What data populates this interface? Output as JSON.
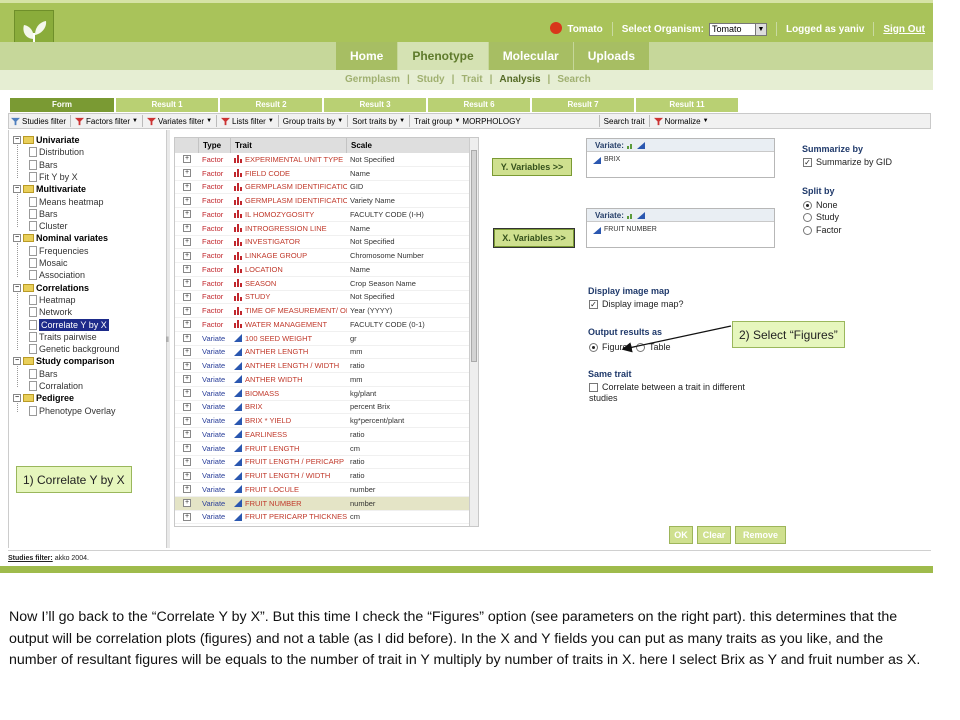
{
  "header": {
    "organism_short": "Tomato",
    "select_organism_label": "Select Organism:",
    "organism_selected": "Tomato",
    "logged_as": "Logged as yaniv",
    "sign_out": "Sign Out"
  },
  "main_tabs": [
    "Home",
    "Phenotype",
    "Molecular",
    "Uploads"
  ],
  "main_tab_active": "Phenotype",
  "sub_nav": [
    "Germplasm",
    "Study",
    "Trait",
    "Analysis",
    "Search"
  ],
  "sub_nav_active": "Analysis",
  "result_tabs": [
    "Form",
    "Result 1",
    "Result 2",
    "Result 3",
    "Result 6",
    "Result 7",
    "Result 11"
  ],
  "toolbar": {
    "studies_filter": "Studies filter",
    "factors_filter": "Factors filter",
    "variates_filter": "Variates filter",
    "lists_filter": "Lists filter",
    "group_traits_by": "Group traits by",
    "sort_traits_by": "Sort traits by",
    "trait_group": "Trait group",
    "trait_group_value": "MORPHOLOGY",
    "search_trait": "Search trait",
    "normalize": "Normalize"
  },
  "tree": {
    "groups": [
      {
        "label": "Univariate",
        "items": [
          "Distribution",
          "Bars",
          "Fit Y by X"
        ]
      },
      {
        "label": "Multivariate",
        "items": [
          "Means heatmap",
          "Bars",
          "Cluster"
        ]
      },
      {
        "label": "Nominal variates",
        "items": [
          "Frequencies",
          "Mosaic",
          "Association"
        ]
      },
      {
        "label": "Correlations",
        "items": [
          "Heatmap",
          "Network",
          "Correlate Y by X",
          "Traits pairwise",
          "Genetic background"
        ]
      },
      {
        "label": "Study comparison",
        "items": [
          "Bars",
          "Corralation"
        ]
      },
      {
        "label": "Pedigree",
        "items": [
          "Phenotype Overlay"
        ]
      }
    ],
    "selected": "Correlate Y by X"
  },
  "table": {
    "headers": [
      "Type",
      "Trait",
      "Scale"
    ],
    "rows": [
      {
        "type": "Factor",
        "trait": "EXPERIMENTAL UNIT TYPE",
        "scale": "Not Specified"
      },
      {
        "type": "Factor",
        "trait": "FIELD CODE",
        "scale": "Name"
      },
      {
        "type": "Factor",
        "trait": "GERMPLASM IDENTIFICATION",
        "scale": "GID"
      },
      {
        "type": "Factor",
        "trait": "GERMPLASM IDENTIFICATION",
        "scale": "Variety Name"
      },
      {
        "type": "Factor",
        "trait": "IL HOMOZYGOSITY",
        "scale": "FACULTY CODE (I-H)"
      },
      {
        "type": "Factor",
        "trait": "INTROGRESSION LINE",
        "scale": "Name"
      },
      {
        "type": "Factor",
        "trait": "INVESTIGATOR",
        "scale": "Not Specified"
      },
      {
        "type": "Factor",
        "trait": "LINKAGE GROUP",
        "scale": "Chromosome Number"
      },
      {
        "type": "Factor",
        "trait": "LOCATION",
        "scale": "Name"
      },
      {
        "type": "Factor",
        "trait": "SEASON",
        "scale": "Crop Season Name"
      },
      {
        "type": "Factor",
        "trait": "STUDY",
        "scale": "Not Specified"
      },
      {
        "type": "Factor",
        "trait": "TIME OF MEASUREMENT/ OBSE",
        "scale": "Year (YYYY)"
      },
      {
        "type": "Factor",
        "trait": "WATER MANAGEMENT",
        "scale": "FACULTY CODE (0-1)"
      },
      {
        "type": "Variate",
        "trait": "100 SEED WEIGHT",
        "scale": "gr"
      },
      {
        "type": "Variate",
        "trait": "ANTHER LENGTH",
        "scale": "mm"
      },
      {
        "type": "Variate",
        "trait": "ANTHER LENGTH / WIDTH",
        "scale": "ratio"
      },
      {
        "type": "Variate",
        "trait": "ANTHER WIDTH",
        "scale": "mm"
      },
      {
        "type": "Variate",
        "trait": "BIOMASS",
        "scale": "kg/plant"
      },
      {
        "type": "Variate",
        "trait": "BRIX",
        "scale": "percent Brix"
      },
      {
        "type": "Variate",
        "trait": "BRIX * YIELD",
        "scale": "kg*percent/plant"
      },
      {
        "type": "Variate",
        "trait": "EARLINESS",
        "scale": "ratio"
      },
      {
        "type": "Variate",
        "trait": "FRUIT LENGTH",
        "scale": "cm"
      },
      {
        "type": "Variate",
        "trait": "FRUIT LENGTH / PERICARP",
        "scale": "ratio"
      },
      {
        "type": "Variate",
        "trait": "FRUIT LENGTH / WIDTH",
        "scale": "ratio"
      },
      {
        "type": "Variate",
        "trait": "FRUIT LOCULE",
        "scale": "number"
      },
      {
        "type": "Variate",
        "trait": "FRUIT NUMBER",
        "scale": "number"
      },
      {
        "type": "Variate",
        "trait": "FRUIT PERICARP THICKNESS",
        "scale": "cm"
      }
    ],
    "selected_row": "FRUIT NUMBER"
  },
  "y_button": "Y. Variables >>",
  "x_button": "X. Variables >>",
  "y_box": {
    "header": "Variate:",
    "item": "BRIX"
  },
  "x_box": {
    "header": "Variate:",
    "item": "FRUIT NUMBER"
  },
  "summarize": {
    "title": "Summarize by",
    "option": "Summarize by GID",
    "checked": true
  },
  "split": {
    "title": "Split by",
    "options": [
      "None",
      "Study",
      "Factor"
    ],
    "selected": "None"
  },
  "image_map": {
    "title": "Display image map",
    "option": "Display image map?",
    "checked": true
  },
  "output": {
    "title": "Output results as",
    "options": [
      "Figures",
      "Table"
    ],
    "selected": "Figures"
  },
  "same_trait": {
    "title": "Same trait",
    "option_line1": "Correlate between a trait in different",
    "option_line2": "studies",
    "checked": false
  },
  "buttons": {
    "ok": "OK",
    "clear": "Clear",
    "remove": "Remove"
  },
  "footer": {
    "label": "Studies filter:",
    "value": "akko 2004."
  },
  "callouts": {
    "left": "1) Correlate Y by X",
    "right": "2) Select “Figures”"
  },
  "narration": "Now I’ll go back to the “Correlate Y by X”. But this time I check the “Figures” option (see parameters on the right part). this determines that the output will be correlation plots (figures) and not a table (as I did before). In the X and Y fields you can put as many traits as you like, and the number of resultant figures will be equals to the number of trait in Y multiply by number of traits in X. here I select Brix as Y and fruit number as X.",
  "colors": {
    "header_green": "#a9c35a",
    "active_tab": "#7a9a33",
    "factor": "#c1272d",
    "variate": "#2a3f9a",
    "selection": "#1d2b8a"
  }
}
